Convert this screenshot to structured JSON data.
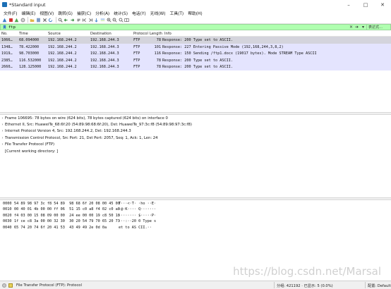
{
  "window": {
    "title": "*Standard input",
    "controls": [
      "–",
      "□",
      "✕"
    ]
  },
  "menu": [
    "文件(F)",
    "编辑(E)",
    "视图(V)",
    "跳转(G)",
    "捕获(C)",
    "分析(A)",
    "统计(S)",
    "电话(Y)",
    "无线(W)",
    "工具(T)",
    "帮助(H)"
  ],
  "filter": {
    "value": "ftp",
    "expression_label": "表达式…",
    "color": "#afffaf"
  },
  "packet_list": {
    "columns": [
      "No.",
      "Time",
      "Source",
      "Destination",
      "Protocol",
      "Length",
      "Info"
    ],
    "rows": [
      {
        "no": "1066…",
        "time": "68.094000",
        "src": "192.168.244.2",
        "dst": "192.168.244.3",
        "proto": "FTP",
        "len": "78",
        "info": "Response: 200 Type set to ASCII.",
        "selected": true
      },
      {
        "no": "1348…",
        "time": "78.422000",
        "src": "192.168.244.2",
        "dst": "192.168.244.3",
        "proto": "FTP",
        "len": "101",
        "info": "Response: 227 Entering Passive Mode (192,168,244,3,8,2)",
        "selected": false
      },
      {
        "no": "1919…",
        "time": "98.703000",
        "src": "192.168.244.2",
        "dst": "192.168.244.3",
        "proto": "FTP",
        "len": "116",
        "info": "Response: 150 Sending /ftp1.docx (19017 bytes). Mode STREAM Type ASCII",
        "selected": false
      },
      {
        "no": "2385…",
        "time": "116.532000",
        "src": "192.168.244.2",
        "dst": "192.168.244.3",
        "proto": "FTP",
        "len": "78",
        "info": "Response: 200 Type set to ASCII.",
        "selected": false
      },
      {
        "no": "2660…",
        "time": "128.125000",
        "src": "192.168.244.2",
        "dst": "192.168.244.3",
        "proto": "FTP",
        "len": "78",
        "info": "Response: 200 Type set to ASCII.",
        "selected": false
      }
    ],
    "row_color": "#e4e4fe"
  },
  "details": [
    {
      "text": "Frame 106695: 78 bytes on wire (624 bits), 78 bytes captured (624 bits) on interface 0",
      "expandable": true
    },
    {
      "text": "Ethernet II, Src: HuaweiTe_68:6f:20 (54:89:98:68:6f:20), Dst: HuaweiTe_97:3c:f8 (54:89:98:97:3c:f8)",
      "expandable": true
    },
    {
      "text": "Internet Protocol Version 4, Src: 192.168.244.2, Dst: 192.168.244.3",
      "expandable": true
    },
    {
      "text": "Transmission Control Protocol, Src Port: 21, Dst Port: 2057, Seq: 1, Ack: 1, Len: 24",
      "expandable": true
    },
    {
      "text": "File Transfer Protocol (FTP)",
      "expandable": true
    },
    {
      "text": "[Current working directory: ]",
      "expandable": false
    }
  ],
  "bytes": [
    {
      "offset": "0000",
      "hex": "54 89 98 97 3c f8 54 89  98 68 6f 20 08 00 45 00",
      "ascii": "T···<·T· ·ho ··E·"
    },
    {
      "offset": "0010",
      "hex": "00 40 01 4b 00 00 ff 06  51 15 c0 a8 f4 02 c0 a8",
      "ascii": "·@·K···· Q·······"
    },
    {
      "offset": "0020",
      "hex": "f4 03 00 15 08 09 00 00  24 ee 00 00 19 c8 50 18",
      "ascii": "········ $·····P·"
    },
    {
      "offset": "0030",
      "hex": "1f ce c8 3a 00 00 32 30  30 20 54 79 70 65 20 73",
      "ascii": "···:··20 0 Type s"
    },
    {
      "offset": "0040",
      "hex": "65 74 20 74 6f 20 41 53  43 49 49 2e 0d 0a",
      "ascii": "et to AS CII.··"
    }
  ],
  "watermark": "https://blog.csdn.net/Marsal",
  "status": {
    "field": "File Transfer Protocol (FTP): Protocol",
    "packets": "分组: 421192 · 已显示: 5 (0.0%)",
    "profile": "配置: Default"
  }
}
